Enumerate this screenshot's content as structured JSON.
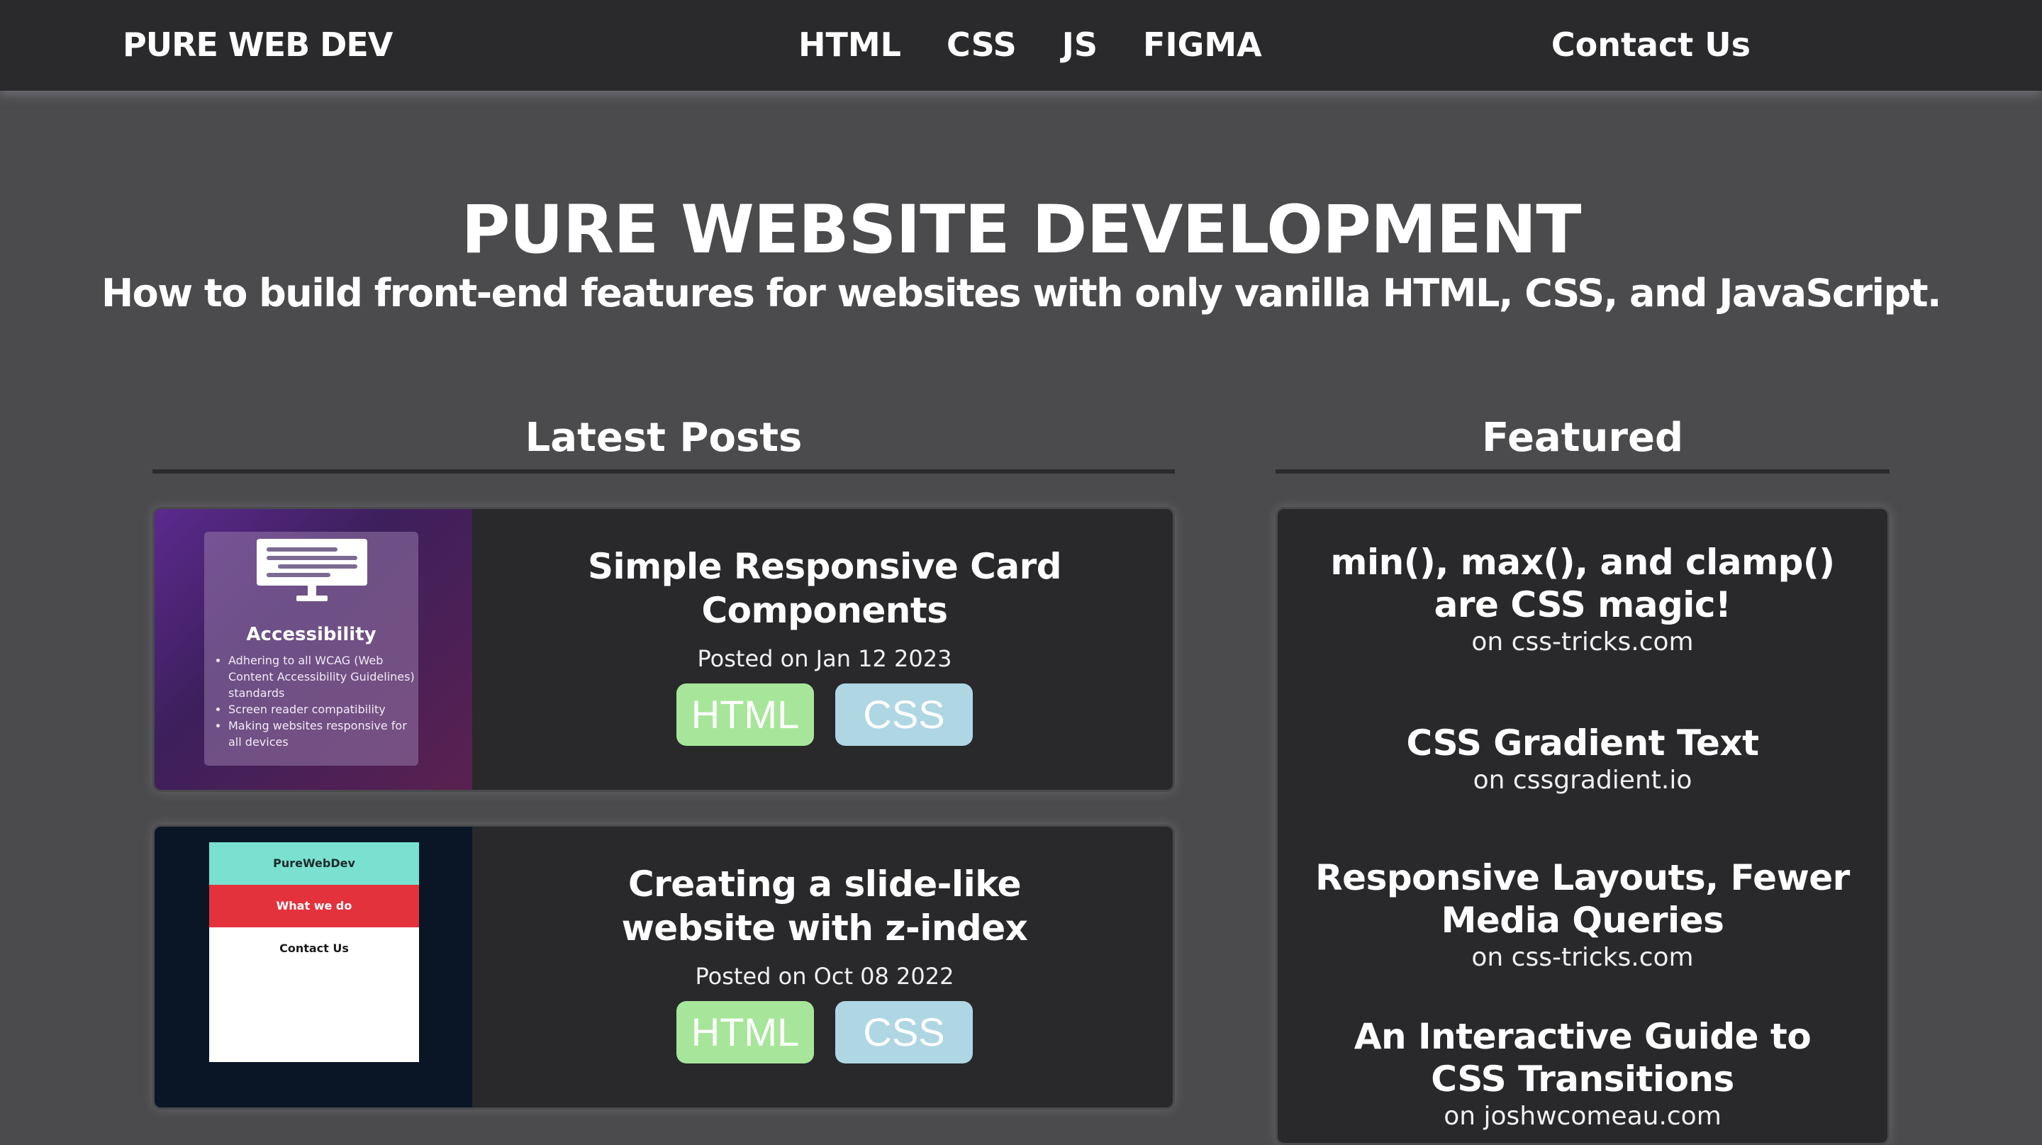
{
  "nav": {
    "brand": "PURE WEB DEV",
    "links": [
      "HTML",
      "CSS",
      "JS",
      "FIGMA"
    ],
    "contact": "Contact Us"
  },
  "hero": {
    "title": "PURE WEBSITE DEVELOPMENT",
    "subtitle": "How to build front-end features for websites with only vanilla HTML, CSS, and JavaScript."
  },
  "sections": {
    "latest": "Latest Posts",
    "featured": "Featured"
  },
  "posts": [
    {
      "title": "Simple Responsive Card Components",
      "date": "Posted on Jan 12 2023",
      "tags": [
        "HTML",
        "CSS"
      ],
      "thumb": {
        "title": "Accessibility",
        "items": [
          "Adhering to all WCAG (Web Content Accessibility Guidelines) standards",
          "Screen reader compatibility",
          "Making websites responsive for all devices"
        ]
      }
    },
    {
      "title": "Creating a slide-like website with z-index",
      "date": "Posted on Oct 08 2022",
      "tags": [
        "HTML",
        "CSS"
      ],
      "thumb": {
        "rows": [
          "PureWebDev",
          "What we do",
          "Contact Us"
        ]
      }
    }
  ],
  "featured": [
    {
      "title": "min(), max(), and clamp() are CSS magic!",
      "source": "on css-tricks.com"
    },
    {
      "title": "CSS Gradient Text",
      "source": "on cssgradient.io"
    },
    {
      "title": "Responsive Layouts, Fewer Media Queries",
      "source": "on css-tricks.com"
    },
    {
      "title": "An Interactive Guide to CSS Transitions",
      "source": "on joshwcomeau.com"
    }
  ],
  "colors": {
    "page_bg": "#4b4b4d",
    "nav_bg": "#2a2a2c",
    "card_bg": "#29282b",
    "tag_html": "#a7e69a",
    "tag_css": "#afd6e3"
  }
}
